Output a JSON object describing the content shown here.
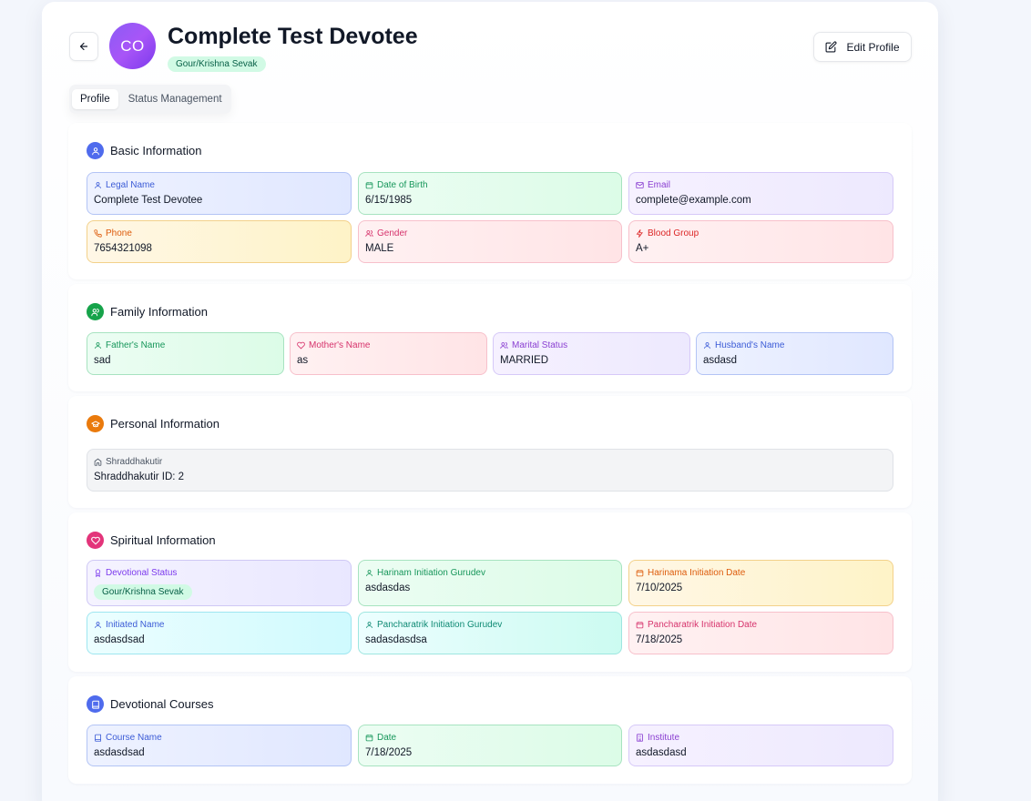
{
  "header": {
    "avatar_initials": "CO",
    "name": "Complete Test Devotee",
    "badge": "Gour/Krishna Sevak",
    "edit_label": "Edit Profile"
  },
  "tabs": [
    {
      "label": "Profile",
      "active": true
    },
    {
      "label": "Status Management",
      "active": false
    }
  ],
  "basic": {
    "title": "Basic Information",
    "fields": [
      {
        "label": "Legal Name",
        "value": "Complete Test Devotee",
        "icon": "user-icon"
      },
      {
        "label": "Date of Birth",
        "value": "6/15/1985",
        "icon": "calendar-icon"
      },
      {
        "label": "Email",
        "value": "complete@example.com",
        "icon": "mail-icon"
      },
      {
        "label": "Phone",
        "value": "7654321098",
        "icon": "phone-icon"
      },
      {
        "label": "Gender",
        "value": "MALE",
        "icon": "users-icon"
      },
      {
        "label": "Blood Group",
        "value": "A+",
        "icon": "activity-icon"
      }
    ]
  },
  "family": {
    "title": "Family Information",
    "fields": [
      {
        "label": "Father's Name",
        "value": "sad",
        "icon": "user-icon"
      },
      {
        "label": "Mother's Name",
        "value": "as",
        "icon": "heart-icon"
      },
      {
        "label": "Marital Status",
        "value": "MARRIED",
        "icon": "users-icon"
      },
      {
        "label": "Husband's Name",
        "value": "asdasd",
        "icon": "user-icon"
      }
    ]
  },
  "personal": {
    "title": "Personal Information",
    "fields": [
      {
        "label": "Shraddhakutir",
        "value": "Shraddhakutir ID: 2",
        "icon": "home-icon"
      }
    ]
  },
  "spiritual": {
    "title": "Spiritual Information",
    "fields": [
      {
        "label": "Devotional Status",
        "value": "Gour/Krishna Sevak",
        "icon": "award-icon"
      },
      {
        "label": "Harinam Initiation Gurudev",
        "value": "asdasdas",
        "icon": "user-icon"
      },
      {
        "label": "Harinama Initiation Date",
        "value": "7/10/2025",
        "icon": "calendar-icon"
      },
      {
        "label": "Initiated Name",
        "value": "asdasdsad",
        "icon": "user-icon"
      },
      {
        "label": "Pancharatrik Initiation Gurudev",
        "value": "sadasdasdsa",
        "icon": "user-icon"
      },
      {
        "label": "Pancharatrik Initiation Date",
        "value": "7/18/2025",
        "icon": "calendar-icon"
      }
    ]
  },
  "courses": {
    "title": "Devotional Courses",
    "fields": [
      {
        "label": "Course Name",
        "value": "asdasdsad",
        "icon": "book-icon"
      },
      {
        "label": "Date",
        "value": "7/18/2025",
        "icon": "calendar-icon"
      },
      {
        "label": "Institute",
        "value": "asdasdasd",
        "icon": "building-icon"
      }
    ]
  },
  "colors": {
    "accent_purple": "#8b5cf6",
    "basic_icon_bg": "#4f6bed",
    "family_icon_bg": "#16a34a",
    "personal_icon_bg": "#ea7a0c",
    "spiritual_icon_bg": "#e3347a",
    "courses_icon_bg": "#4f6bed"
  }
}
